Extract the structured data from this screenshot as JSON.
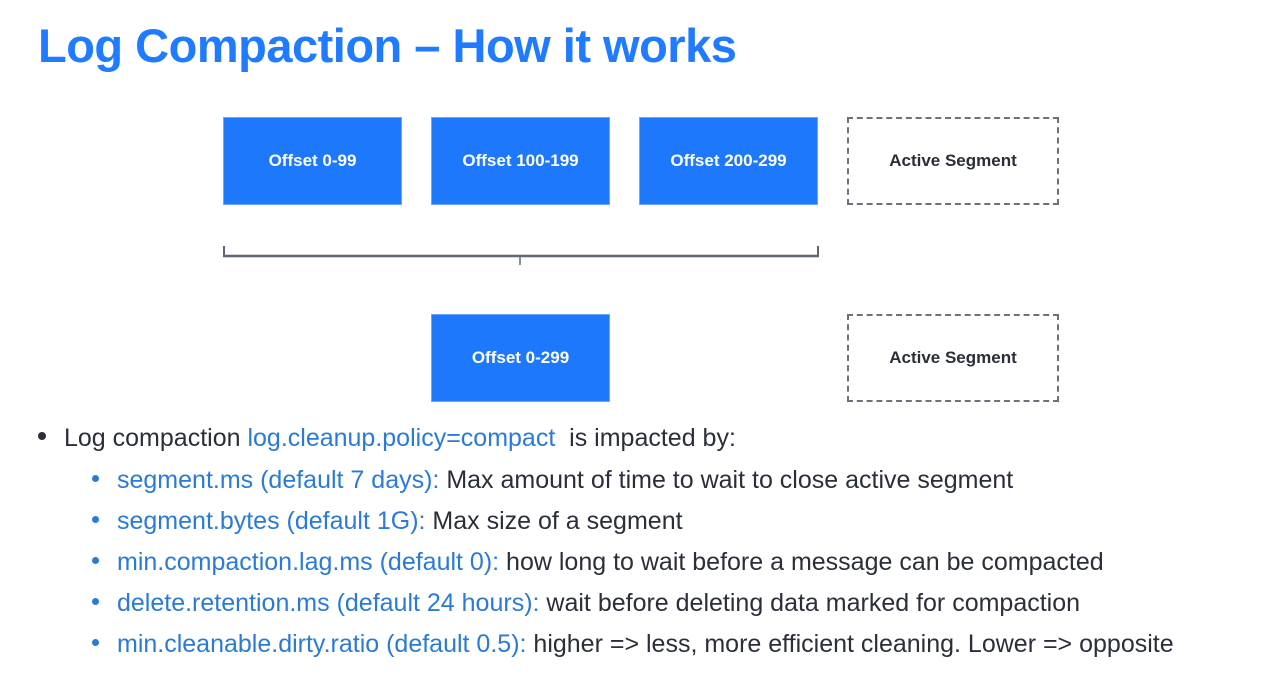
{
  "title": "Log Compaction – How it works",
  "diagram": {
    "row1": {
      "segments": [
        {
          "label": "Offset 0-99"
        },
        {
          "label": "Offset 100-199"
        },
        {
          "label": "Offset 200-299"
        }
      ],
      "active": "Active Segment"
    },
    "row2": {
      "segments": [
        {
          "label": "Offset 0-299"
        }
      ],
      "active": "Active Segment"
    },
    "colors": {
      "segment_fill": "#1d78fc",
      "title": "#1f7bff",
      "keyword": "#2a7bd6",
      "bracket": "#5f6675"
    }
  },
  "bullets": {
    "main": {
      "prefix": "Log compaction ",
      "keyword": "log.cleanup.policy=compact",
      "suffix": "  is impacted by:"
    },
    "sub": [
      {
        "keyword": "segment.ms (default 7 days):",
        "text": " Max amount of time to wait to close active segment"
      },
      {
        "keyword": "segment.bytes (default 1G):",
        "text": " Max size of a segment"
      },
      {
        "keyword": "min.compaction.lag.ms (default 0):",
        "text": " how long to wait before a message can be compacted"
      },
      {
        "keyword": "delete.retention.ms (default 24 hours):",
        "text": " wait before deleting data marked for compaction"
      },
      {
        "keyword": "min.cleanable.dirty.ratio (default 0.5):",
        "text": " higher => less, more efficient cleaning. Lower => opposite"
      }
    ]
  }
}
